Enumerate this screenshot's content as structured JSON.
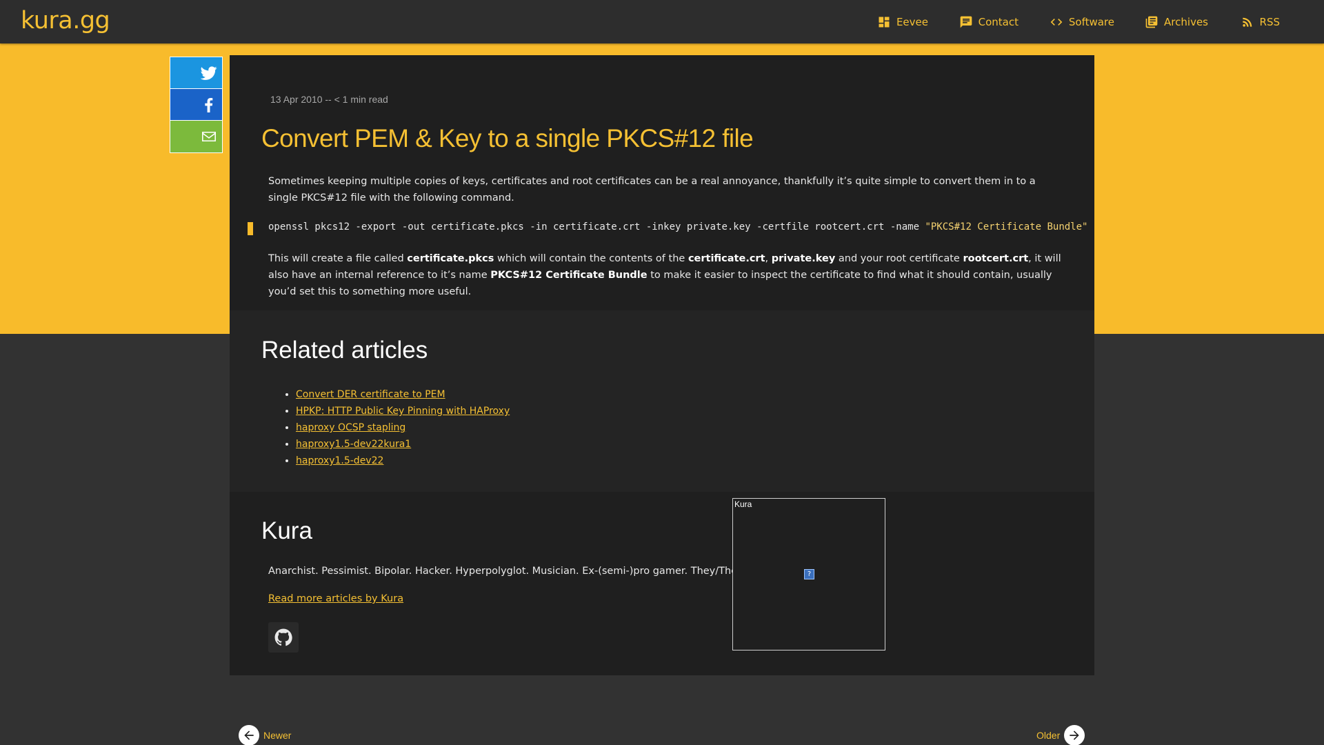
{
  "site": {
    "logo": "kura.gg"
  },
  "nav": [
    {
      "label": "Eevee",
      "icon": "dashboard-icon"
    },
    {
      "label": "Contact",
      "icon": "chat-icon"
    },
    {
      "label": "Software",
      "icon": "code-icon"
    },
    {
      "label": "Archives",
      "icon": "library-icon"
    },
    {
      "label": "RSS",
      "icon": "rss-icon"
    }
  ],
  "share": [
    {
      "icon": "twitter-icon",
      "color": "#1b95e0"
    },
    {
      "icon": "facebook-icon",
      "color": "#1a63c8"
    },
    {
      "icon": "email-icon",
      "color": "#7cba3c"
    }
  ],
  "post": {
    "meta": "13 Apr 2010 -- < 1 min read",
    "title": "Convert PEM & Key to a single PKCS#12 file",
    "intro": "Sometimes keeping multiple copies of keys, certificates and root certificates can be a real annoyance, thankfully it’s quite simple to convert them in to a single PKCS#12 file with the following command.",
    "code_cmd": "openssl pkcs12 -export -out certificate.pkcs -in certificate.crt -inkey private.key -certfile rootcert.crt -name ",
    "code_str": "\"PKCS#12 Certificate Bundle\"",
    "outro": {
      "t1": "This will create a file called ",
      "b1": "certificate.pkcs",
      "t2": " which will contain the contents of the ",
      "b2": "certificate.crt",
      "t3": ", ",
      "b3": "private.key",
      "t4": " and your root certificate ",
      "b4": "rootcert.crt",
      "t5": ", it will also have an internal reference to it’s name ",
      "b5": "PKCS#12 Certificate Bundle",
      "t6": " to make it easier to inspect the certificate to find what it should contain, usually you’d set this to something more useful."
    }
  },
  "related": {
    "heading": "Related articles",
    "items": [
      "Convert DER certificate to PEM",
      "HPKP: HTTP Public Key Pinning with HAProxy",
      "haproxy OCSP stapling",
      "haproxy1.5-dev22kura1",
      "haproxy1.5-dev22"
    ]
  },
  "author": {
    "name": "Kura",
    "bio": "Anarchist. Pessimist. Bipolar. Hacker. Hyperpolyglot. Musician. Ex-(semi-)pro gamer. They/Them.",
    "more_link": "Read more articles by Kura",
    "avatar_alt": "Kura",
    "social_icon": "github-icon"
  },
  "pager": {
    "newer": "Newer",
    "older": "Older"
  },
  "colors": {
    "accent": "#f5c033",
    "band": "#f8bb2b",
    "card": "#1f1f1f",
    "page": "#323232"
  }
}
